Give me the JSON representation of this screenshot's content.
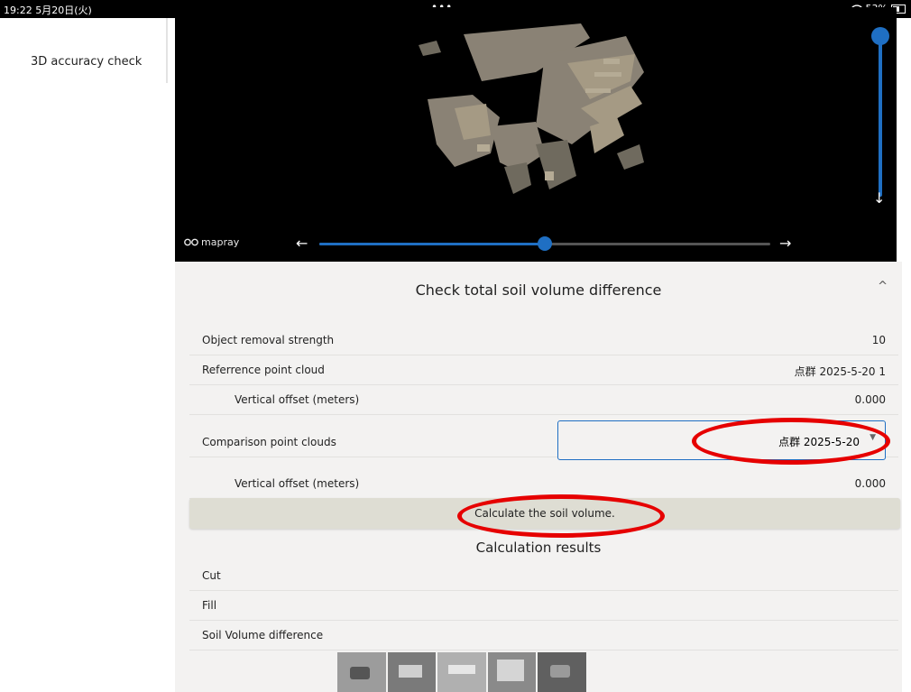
{
  "status_bar": {
    "time": "19:22 5月20日(火)",
    "dots": "•••",
    "battery": "53%"
  },
  "sidebar": {
    "items": [
      {
        "label": "3D accuracy check"
      }
    ]
  },
  "viewer": {
    "logo": "mapray",
    "h_slider_value_pct": 50,
    "v_slider_value_pct": 100,
    "left_arrow": "←",
    "right_arrow": "→",
    "down_arrow": "↓"
  },
  "panel": {
    "title": "Check total soil volume difference",
    "collapse_icon": "chevron-up-icon",
    "collapse_glyph": "^",
    "rows": [
      {
        "label": "Object removal strength",
        "value": "10"
      },
      {
        "label": "Referrence point cloud",
        "value": "点群 2025-5-20 1"
      },
      {
        "label": "Vertical offset (meters)",
        "value": "0.000"
      },
      {
        "label": "Comparison point clouds",
        "value": "点群 2025-5-20"
      },
      {
        "label": "Vertical offset (meters)",
        "value": "0.000"
      }
    ],
    "select_caret": "▼",
    "calculate_button": "Calculate the soil volume.",
    "results_title": "Calculation results",
    "results": [
      {
        "label": "Cut",
        "value": ""
      },
      {
        "label": "Fill",
        "value": ""
      },
      {
        "label": "Soil Volume difference",
        "value": ""
      }
    ]
  },
  "colors": {
    "accent": "#1f6fc3",
    "annotation": "#e60000",
    "panel_bg": "#f3f2f1",
    "button_bg": "#deddd3"
  }
}
